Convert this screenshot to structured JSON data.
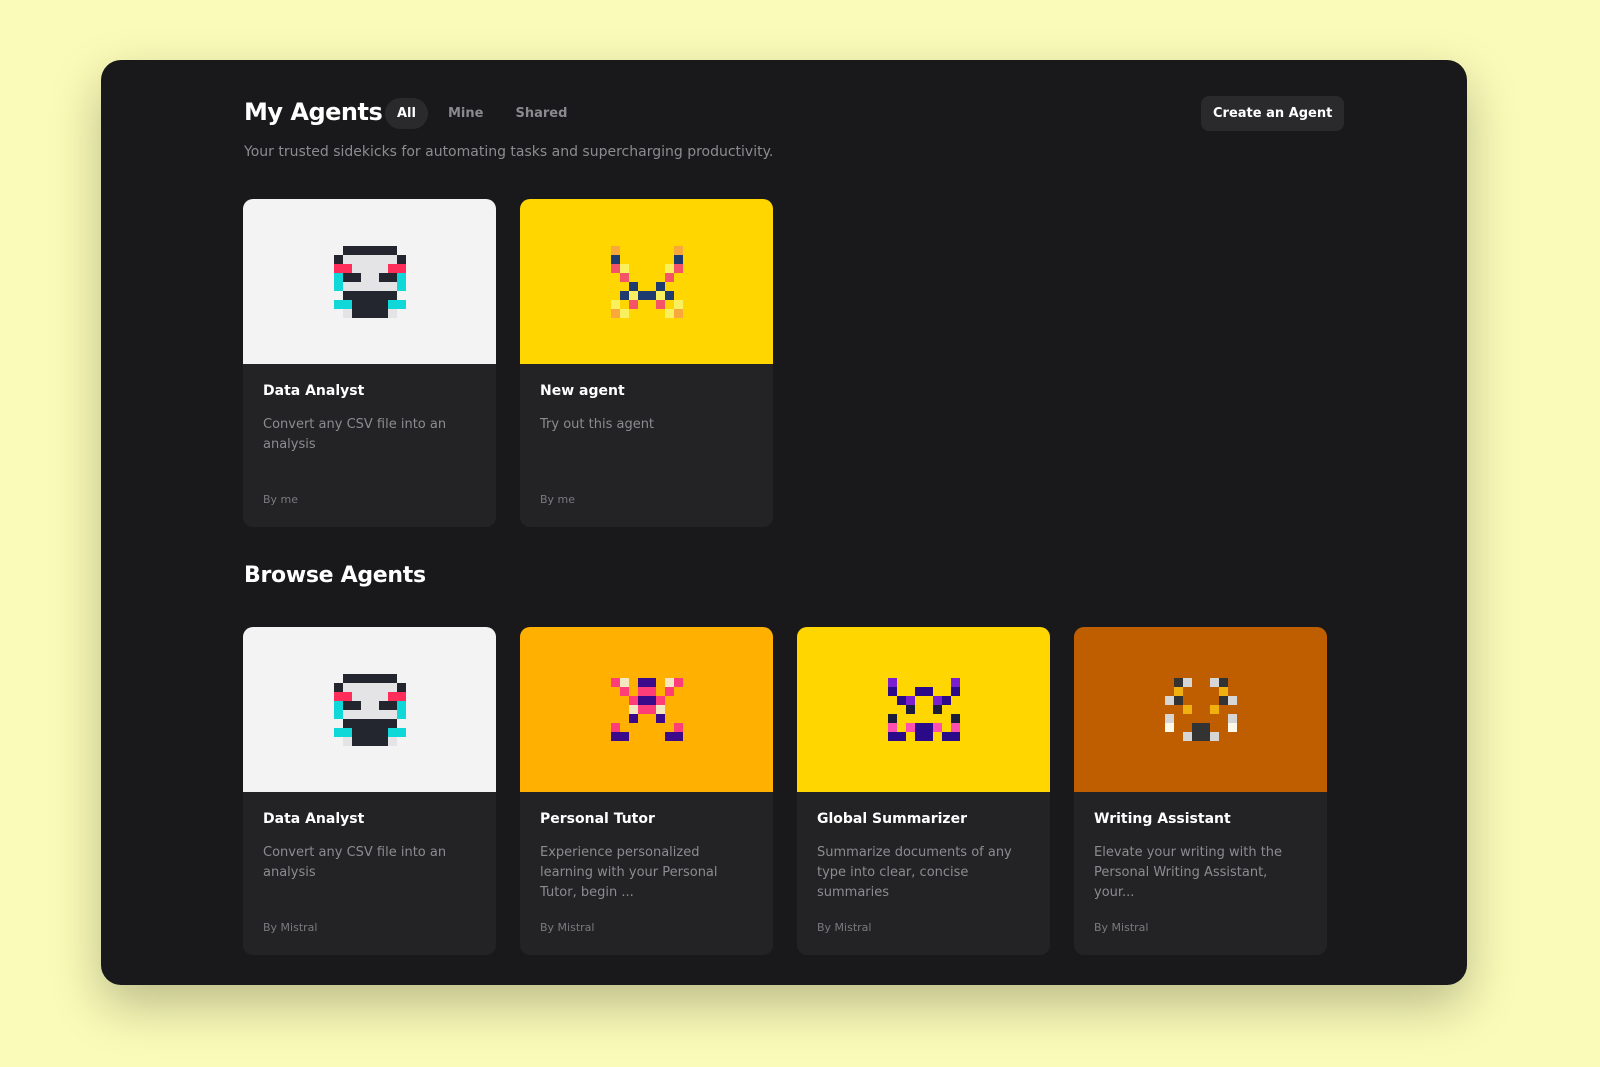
{
  "header": {
    "title": "My Agents",
    "tabs": [
      "All",
      "Mine",
      "Shared"
    ],
    "active_tab": "All",
    "subtitle": "Your trusted sidekicks for automating tasks and supercharging productivity.",
    "create_label": "Create an Agent"
  },
  "my_agents": [
    {
      "name": "Data Analyst",
      "description": "Convert any CSV file into an analysis",
      "author": "By me",
      "color": "#f3f3f4",
      "icon": "data-analyst-avatar-icon"
    },
    {
      "name": "New agent",
      "description": "Try out this agent",
      "author": "By me",
      "color": "#ffd600",
      "icon": "new-agent-avatar-icon"
    }
  ],
  "browse": {
    "title": "Browse Agents",
    "agents": [
      {
        "name": "Data Analyst",
        "description": "Convert any CSV file into an analysis",
        "author": "By Mistral",
        "color": "#f3f3f4",
        "icon": "data-analyst-avatar-icon"
      },
      {
        "name": "Personal Tutor",
        "description": "Experience personalized learning with your Personal Tutor, begin ...",
        "author": "By Mistral",
        "color": "#ffb000",
        "icon": "personal-tutor-avatar-icon"
      },
      {
        "name": "Global Summarizer",
        "description": "Summarize documents of any type into clear, concise summaries",
        "author": "By Mistral",
        "color": "#ffd600",
        "icon": "global-summarizer-avatar-icon"
      },
      {
        "name": "Writing Assistant",
        "description": "Elevate your writing with the Personal Writing Assistant, your...",
        "author": "By Mistral",
        "color": "#bf5e00",
        "icon": "writing-assistant-avatar-icon"
      }
    ]
  }
}
